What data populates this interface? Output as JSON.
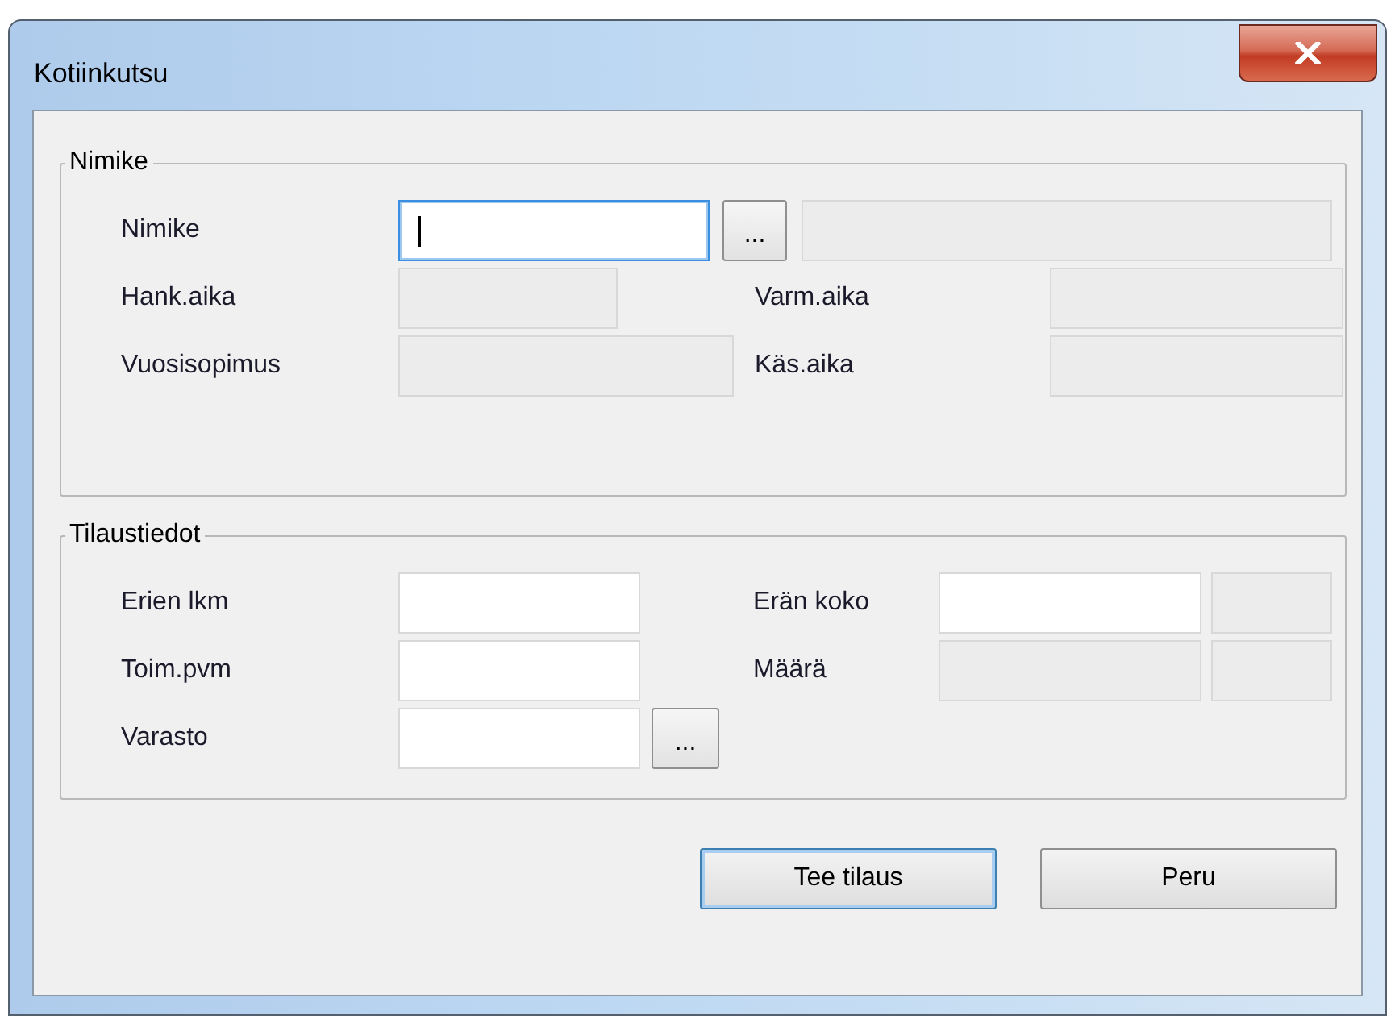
{
  "window": {
    "title": "Kotiinkutsu"
  },
  "groups": [
    {
      "title": "Nimike",
      "rows": [
        {
          "cells": [
            {
              "kind": "label",
              "text": "Nimike"
            },
            {
              "kind": "field",
              "disabled": false,
              "focused": true
            },
            {
              "kind": "browse",
              "text": "..."
            },
            {
              "kind": "field",
              "disabled": true,
              "focused": false
            }
          ]
        },
        {
          "cells": [
            {
              "kind": "label",
              "text": "Hank.aika"
            },
            {
              "kind": "field",
              "disabled": true,
              "focused": false
            },
            {
              "kind": "label",
              "text": "Varm.aika"
            },
            {
              "kind": "field",
              "disabled": true,
              "focused": false
            }
          ]
        },
        {
          "cells": [
            {
              "kind": "label",
              "text": "Vuosisopimus"
            },
            {
              "kind": "field",
              "disabled": true,
              "focused": false
            },
            {
              "kind": "label",
              "text": "Käs.aika"
            },
            {
              "kind": "field",
              "disabled": true,
              "focused": false
            }
          ]
        }
      ]
    },
    {
      "title": "Tilaustiedot",
      "rows": [
        {
          "cells": [
            {
              "kind": "label",
              "text": "Erien lkm"
            },
            {
              "kind": "field",
              "disabled": false,
              "focused": false
            },
            {
              "kind": "label",
              "text": "Erän koko"
            },
            {
              "kind": "field",
              "disabled": false,
              "focused": false
            },
            {
              "kind": "field",
              "disabled": true,
              "focused": false
            }
          ]
        },
        {
          "cells": [
            {
              "kind": "label",
              "text": "Toim.pvm"
            },
            {
              "kind": "field",
              "disabled": false,
              "focused": false
            },
            {
              "kind": "label",
              "text": "Määrä"
            },
            {
              "kind": "field",
              "disabled": true,
              "focused": false
            },
            {
              "kind": "field",
              "disabled": true,
              "focused": false
            }
          ]
        },
        {
          "cells": [
            {
              "kind": "label",
              "text": "Varasto"
            },
            {
              "kind": "field",
              "disabled": false,
              "focused": false
            },
            {
              "kind": "browse",
              "text": "..."
            }
          ]
        }
      ]
    }
  ],
  "buttons": [
    {
      "label": "Tee tilaus",
      "default": true
    },
    {
      "label": "Peru",
      "default": false
    }
  ]
}
